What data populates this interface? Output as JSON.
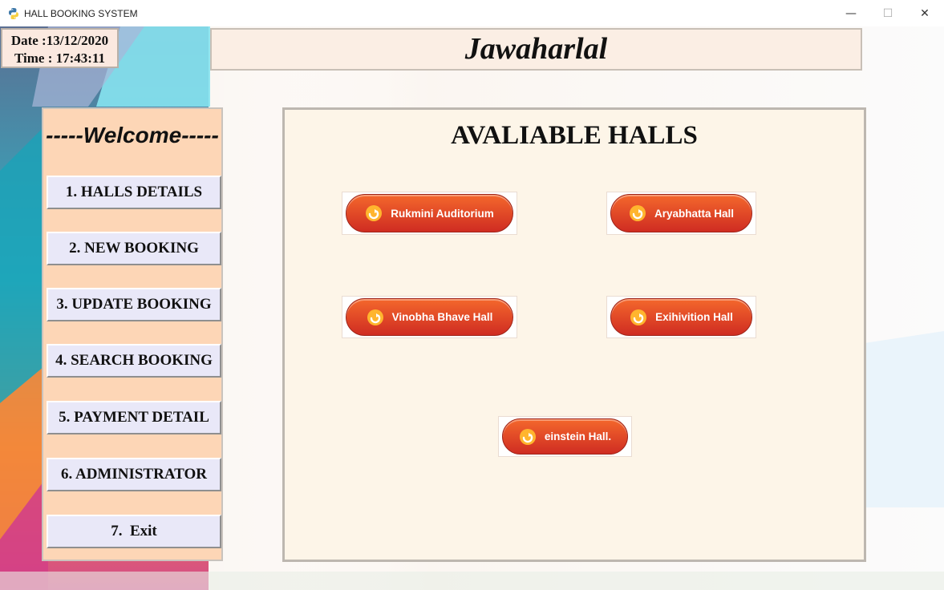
{
  "window": {
    "title": "HALL BOOKING SYSTEM"
  },
  "datetime": {
    "date": "Date :13/12/2020",
    "time": "Time : 17:43:11"
  },
  "header": {
    "title": "Jawaharlal"
  },
  "menu": {
    "welcome": "-----Welcome-----",
    "items": [
      {
        "label": "1. HALLS DETAILS"
      },
      {
        "label": "2. NEW BOOKING"
      },
      {
        "label": "3. UPDATE BOOKING"
      },
      {
        "label": "4. SEARCH BOOKING"
      },
      {
        "label": "5. PAYMENT DETAIL"
      },
      {
        "label": "6. ADMINISTRATOR"
      },
      {
        "label": "7.  Exit"
      }
    ]
  },
  "panel": {
    "title": "AVALIABLE HALLS",
    "halls": [
      {
        "label": "Rukmini Auditorium"
      },
      {
        "label": "Aryabhatta Hall"
      },
      {
        "label": "Vinobha Bhave Hall"
      },
      {
        "label": "Exihivition Hall"
      },
      {
        "label": "einstein Hall."
      }
    ]
  },
  "icons": {
    "app": "python-icon",
    "hall_button": "refresh-arrow-icon"
  },
  "colors": {
    "menu_bg": "#fdd6b6",
    "panel_bg": "#fdf5e8",
    "button_orange": "#e8462a",
    "menu_button_bg": "#e9e8f8"
  }
}
